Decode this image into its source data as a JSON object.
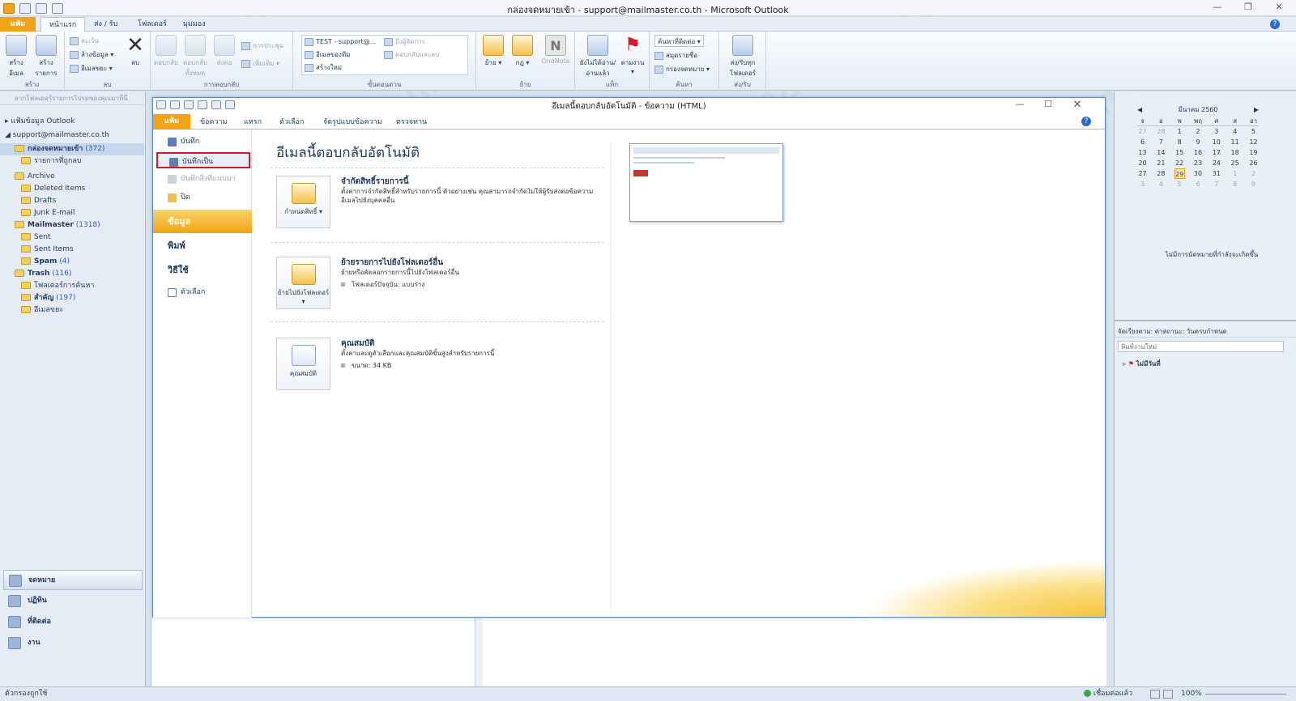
{
  "outlook": {
    "title": "กล่องจดหมายเข้า - support@mailmaster.co.th - Microsoft Outlook",
    "tabs": [
      "แฟ้ม",
      "หน้าแรก",
      "ส่ง / รับ",
      "โฟลเดอร์",
      "มุมมอง"
    ],
    "ribbon": {
      "new_mail": "สร้างอีเมล",
      "new_items": "สร้างรายการ",
      "group_new": "สร้าง",
      "ignore": "ละเว้น",
      "cleanup": "ล้างข้อมูล",
      "junk": "อีเมลขยะ",
      "delete": "ลบ",
      "group_delete": "ลบ",
      "reply": "ตอบกลับ",
      "reply_all": "ตอบกลับทั้งหมด",
      "forward": "ส่งต่อ",
      "meeting": "การประชุม",
      "more": "เพิ่มเติม",
      "group_respond": "การตอบกลับ",
      "qs_test": "TEST - support@...",
      "qs_team": "อีเมลของทีม",
      "qs_new": "สร้างใหม่",
      "qs_manager": "ถึงผู้จัดการ",
      "qs_reply_delete": "ตอบกลับและลบ",
      "group_quicksteps": "ขั้นตอนด่วน",
      "move": "ย้าย",
      "rules": "กฎ",
      "onenote": "OneNote",
      "group_move": "ย้าย",
      "unread": "ยังไม่ได้อ่าน/อ่านแล้ว",
      "followup": "ตามงาน",
      "group_tags": "แท็ก",
      "find_contact": "ค้นหาที่ติดต่อ",
      "address_book": "สมุดรายชื่อ",
      "filter_email": "กรองจดหมาย",
      "group_find": "ค้นหา",
      "send_receive_all": "ส่ง/รับทุกโฟลเดอร์",
      "group_send_receive": "ส่ง/รับ"
    },
    "nav": {
      "header": "ลากโฟลเดอร์รายการโปรดของคุณมาที่นี่",
      "data_file": "แฟ้มข้อมูล Outlook",
      "account": "support@mailmaster.co.th",
      "folders": [
        {
          "name": "กล่องจดหมายเข้า",
          "count": "(372)"
        },
        {
          "name": "รายการที่ถูกลบ",
          "count": ""
        },
        {
          "name": "Archive",
          "count": ""
        },
        {
          "name": "Deleted Items",
          "count": ""
        },
        {
          "name": "Drafts",
          "count": ""
        },
        {
          "name": "Junk E-mail",
          "count": ""
        },
        {
          "name": "Mailmaster",
          "count": "(1318)"
        },
        {
          "name": "Sent",
          "count": ""
        },
        {
          "name": "Sent Items",
          "count": ""
        },
        {
          "name": "Spam",
          "count": "(4)"
        },
        {
          "name": "Trash",
          "count": "(116)"
        },
        {
          "name": "โฟลเดอร์การค้นหา",
          "count": ""
        },
        {
          "name": "สำคัญ",
          "count": "(197)"
        },
        {
          "name": "อีเมลขยะ",
          "count": ""
        }
      ],
      "mail": "จดหมาย",
      "calendar": "ปฏิทิน",
      "contacts": "ที่ติดต่อ",
      "tasks": "งาน"
    },
    "todo": {
      "month": "มีนาคม 2560",
      "weekdays": [
        "จ",
        "อ",
        "พ",
        "พฤ",
        "ศ",
        "ส",
        "อา"
      ],
      "weeks": [
        [
          "27",
          "28",
          "1",
          "2",
          "3",
          "4",
          "5"
        ],
        [
          "6",
          "7",
          "8",
          "9",
          "10",
          "11",
          "12"
        ],
        [
          "13",
          "14",
          "15",
          "16",
          "17",
          "18",
          "19"
        ],
        [
          "20",
          "21",
          "22",
          "23",
          "24",
          "25",
          "26"
        ],
        [
          "27",
          "28",
          "29",
          "30",
          "31",
          "1",
          "2"
        ],
        [
          "3",
          "4",
          "5",
          "6",
          "7",
          "8",
          "9"
        ]
      ],
      "no_appointments": "ไม่มีการนัดหมายที่กำลังจะเกิดขึ้น",
      "arrange": "จัดเรียงตาม: ค่าสถานะ: วันครบกำหนด",
      "new_task_placeholder": "พิมพ์งานใหม่",
      "no_date": "ไม่มีวันที่"
    },
    "status": {
      "left": "ตัวกรองถูกใช้",
      "connected": "เชื่อมต่อแล้ว",
      "zoom": "100%"
    }
  },
  "message": {
    "title": "อีเมลนี้ตอบกลับอัตโนมัติ - ข้อความ (HTML)",
    "tabs": [
      "แฟ้ม",
      "ข้อความ",
      "แทรก",
      "ตัวเลือก",
      "จัดรูปแบบข้อความ",
      "ตรวจทาน"
    ],
    "backstage": {
      "save": "บันทึก",
      "save_as": "บันทึกเป็น",
      "save_attachments": "บันทึกสิ่งที่แนบมา",
      "close": "ปิด",
      "info": "ข้อมูล",
      "print": "พิมพ์",
      "help": "วิธีใช้",
      "options": "ตัวเลือก"
    },
    "info": {
      "heading": "อีเมลนี้ตอบกลับอัตโนมัติ",
      "perm_button": "กำหนดสิทธิ์",
      "perm_title": "จำกัดสิทธิ์รายการนี้",
      "perm_desc": "ตั้งค่าการจำกัดสิทธิ์สำหรับรายการนี้ ตัวอย่างเช่น คุณสามารถจำกัดไม่ให้ผู้รับส่งต่อข้อความอีเมลไปยังบุคคลอื่น",
      "move_button": "ย้ายไปยังโฟลเดอร์",
      "move_title": "ย้ายรายการไปยังโฟลเดอร์อื่น",
      "move_desc": "ย้ายหรือคัดลอกรายการนี้ไปยังโฟลเดอร์อื่น",
      "current_folder": "โฟลเดอร์ปัจจุบัน:   แบบร่าง",
      "prop_button": "คุณสมบัติ",
      "prop_title": "คุณสมบัติ",
      "prop_desc": "ตั้งค่าและดูตัวเลือกและคุณสมบัติขั้นสูงสำหรับรายการนี้",
      "size": "ขนาด:     34 KB"
    }
  },
  "watermark": "mail master",
  "colors": {
    "accent": "#f0a317",
    "highlight_border": "#d11a2a",
    "link": "#2b5fb4"
  }
}
